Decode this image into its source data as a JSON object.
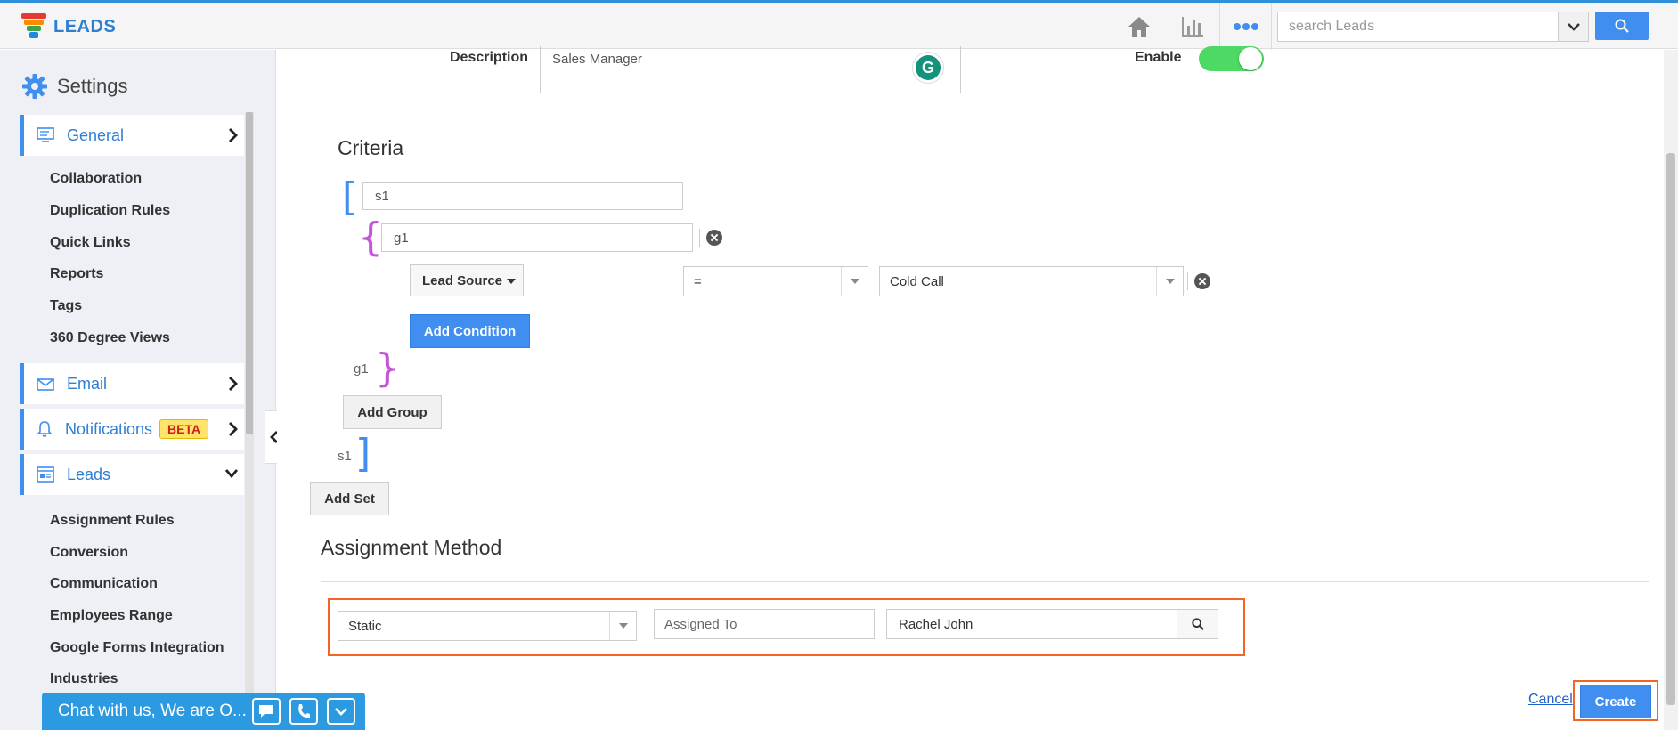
{
  "app": {
    "name": "LEADS"
  },
  "topbar": {
    "search": {
      "placeholder": "search Leads"
    },
    "icons": [
      "home-icon",
      "bar-chart-icon",
      "more-dots-icon",
      "chevron-down-icon",
      "search-icon"
    ]
  },
  "sidebar": {
    "title": "Settings",
    "sections": {
      "general": {
        "label": "General"
      },
      "email": {
        "label": "Email"
      },
      "notifications": {
        "label": "Notifications",
        "badge": "BETA"
      },
      "leads": {
        "label": "Leads"
      }
    },
    "general_items": [
      "Collaboration",
      "Duplication Rules",
      "Quick Links",
      "Reports",
      "Tags",
      "360 Degree Views"
    ],
    "leads_items": [
      "Assignment Rules",
      "Conversion",
      "Communication",
      "Employees Range",
      "Google Forms Integration",
      "Industries"
    ]
  },
  "chat": {
    "text": "Chat with us, We are O..."
  },
  "form": {
    "description_label": "Description",
    "description_value": "Sales Manager",
    "enable_label": "Enable",
    "enable_on": true
  },
  "criteria": {
    "title": "Criteria",
    "set_name": "s1",
    "group_name": "g1",
    "group_end_label": "g1",
    "set_end_label": "s1",
    "condition": {
      "field": "Lead Source",
      "operator": "=",
      "value": "Cold Call"
    },
    "add_condition": "Add Condition",
    "add_group": "Add Group",
    "add_set": "Add Set"
  },
  "assignment": {
    "title": "Assignment Method",
    "method": "Static",
    "assigned_to_label": "Assigned To",
    "assigned_to_value": "Rachel John"
  },
  "actions": {
    "cancel": "Cancel",
    "create": "Create"
  },
  "colors": {
    "accent": "#3f8ef0",
    "highlight": "#f26522",
    "toggle_on": "#4cd964",
    "set_bracket": "#3f8ef0",
    "group_bracket": "#c355d8"
  }
}
